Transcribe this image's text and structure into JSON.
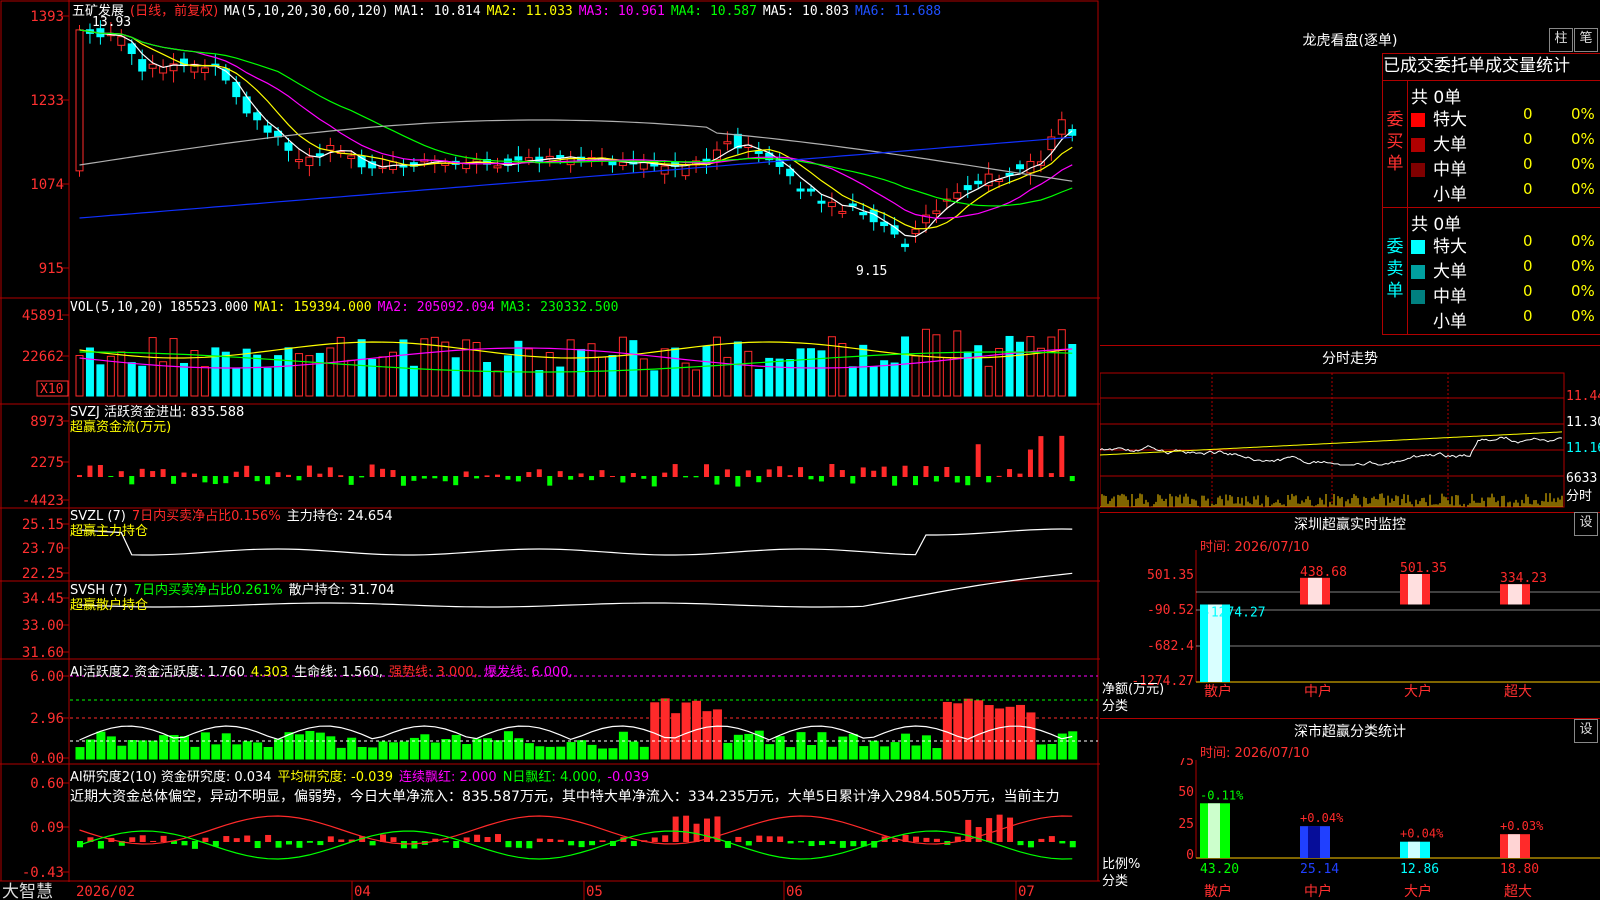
{
  "app": {
    "brand": "大智慧"
  },
  "colors": {
    "up": "#ff2a2a",
    "down": "#00ffff",
    "grid": "#b00000",
    "ma1": "#ffffff",
    "ma2": "#ffff00",
    "ma3": "#ff00ff",
    "ma4": "#00ff00",
    "ma5": "#b0b0b0",
    "ma6": "#1030ff"
  },
  "chart": {
    "stock": "五矿发展",
    "period": "(日线，前复权)",
    "ma_label": "MA(5,10,20,30,60,120)",
    "ma1": "MA1: 10.814",
    "ma2": "MA2: 11.033",
    "ma3": "MA3: 10.961",
    "ma4": "MA4: 10.587",
    "ma5": "MA5: 10.803",
    "ma6": "MA6: 11.688",
    "high_label": "13.93",
    "low_label": "9.15",
    "y_ticks": [
      "1393",
      "1233",
      "1074",
      "915"
    ]
  },
  "vol": {
    "label": "VOL(5,10,20)",
    "value": "185523.000",
    "ma1": "MA1: 159394.000",
    "ma2": "MA2: 205092.094",
    "ma3": "MA3: 230332.500",
    "y_ticks": [
      "45891",
      "22662"
    ],
    "unit": "X10"
  },
  "svzj": {
    "label": "SVZJ  活跃资金进出: 835.588",
    "sub": "超赢资金流(万元)",
    "y_ticks": [
      "8973",
      "2275",
      "-4423"
    ]
  },
  "svzl": {
    "label": "SVZL (7)",
    "pct": "7日内买卖净占比0.156%",
    "hold": "主力持仓: 24.654",
    "sub": "超赢主力持仓",
    "y_ticks": [
      "25.15",
      "23.70",
      "22.25"
    ]
  },
  "svsh": {
    "label": "SVSH (7)",
    "pct": "7日内买卖净占比0.261%",
    "hold": "散户持仓: 31.704",
    "sub": "超赢散户持仓",
    "y_ticks": [
      "34.45",
      "33.00",
      "31.60"
    ]
  },
  "ai_act": {
    "label": "AI活跃度2 资金活跃度: 1.760",
    "v2": "4.303",
    "life": "生命线: 1.560,",
    "strong": "强势线: 3.000,",
    "burst": "爆发线: 6.000,",
    "y_ticks": [
      "6.00",
      "2.96",
      "0.00"
    ]
  },
  "ai_res": {
    "label": "AI研究度2(10) 资金研究度: 0.034",
    "avg": "平均研究度: -0.039",
    "red": "连续飘红: 2.000",
    "nred": "N日飘红: 4.000,",
    "neg": "-0.039",
    "comment": "近期大资金总体偏空，异动不明显，偏弱势，今日大单净流入：835.587万元，其中特大单净流入：334.235万元，大单5日累计净入2984.505万元，当前主力",
    "y_ticks": [
      "0.60",
      "0.09",
      "-0.43"
    ]
  },
  "xaxis": [
    "2026/02",
    "04",
    "05",
    "06",
    "07"
  ],
  "right": {
    "lhb_title": "龙虎看盘(逐单)",
    "btn_zhu": "柱",
    "btn_bi": "笔",
    "tabs": [
      "已成交",
      "委托单",
      "成交量统计"
    ],
    "buy_side": "委买单",
    "sell_side": "委卖单",
    "buy_total": "共 0单",
    "sell_total": "共 0单",
    "buy_rows": [
      {
        "name": "特大",
        "count": "0",
        "pct": "0%",
        "color": "#ff0000"
      },
      {
        "name": "大单",
        "count": "0",
        "pct": "0%",
        "color": "#b00000"
      },
      {
        "name": "中单",
        "count": "0",
        "pct": "0%",
        "color": "#800000"
      },
      {
        "name": "小单",
        "count": "0",
        "pct": "0%",
        "color": "#000000"
      }
    ],
    "sell_rows": [
      {
        "name": "特大",
        "count": "0",
        "pct": "0%",
        "color": "#00ffff"
      },
      {
        "name": "大单",
        "count": "0",
        "pct": "0%",
        "color": "#00a0a0"
      },
      {
        "name": "中单",
        "count": "0",
        "pct": "0%",
        "color": "#008080"
      },
      {
        "name": "小单",
        "count": "0",
        "pct": "0%",
        "color": "#000000"
      }
    ],
    "intraday_title": "分时走势",
    "intraday_ticks": [
      "11.44",
      "11.30",
      "11.16"
    ],
    "intraday_vol": "6633",
    "intraday_vol_label": "分时",
    "monitor_title": "深圳超赢实时监控",
    "monitor_btn": "设",
    "monitor_time": "时间: 2026/07/10",
    "monitor_ticks": [
      "501.35",
      "-90.52",
      "-682.4",
      "-1274.27"
    ],
    "monitor_unit": "净额(万元)",
    "monitor_cat": "分类",
    "monitor_bars": [
      {
        "name": "散户",
        "value": "-1274.27"
      },
      {
        "name": "中户",
        "value": "438.68"
      },
      {
        "name": "大户",
        "value": "501.35"
      },
      {
        "name": "超大",
        "value": "334.23"
      }
    ],
    "stats_title": "深市超赢分类统计",
    "stats_btn": "设",
    "stats_time": "时间: 2026/07/10",
    "stats_ticks": [
      "75",
      "50",
      "25",
      "0"
    ],
    "stats_unit": "比例%",
    "stats_cat": "分类",
    "stats_bars": [
      {
        "name": "散户",
        "value": "43.20",
        "delta": "-0.11%"
      },
      {
        "name": "中户",
        "value": "25.14",
        "delta": "+0.04%"
      },
      {
        "name": "大户",
        "value": "12.86",
        "delta": "+0.04%"
      },
      {
        "name": "超大",
        "value": "18.80",
        "delta": "+0.03%"
      }
    ]
  }
}
